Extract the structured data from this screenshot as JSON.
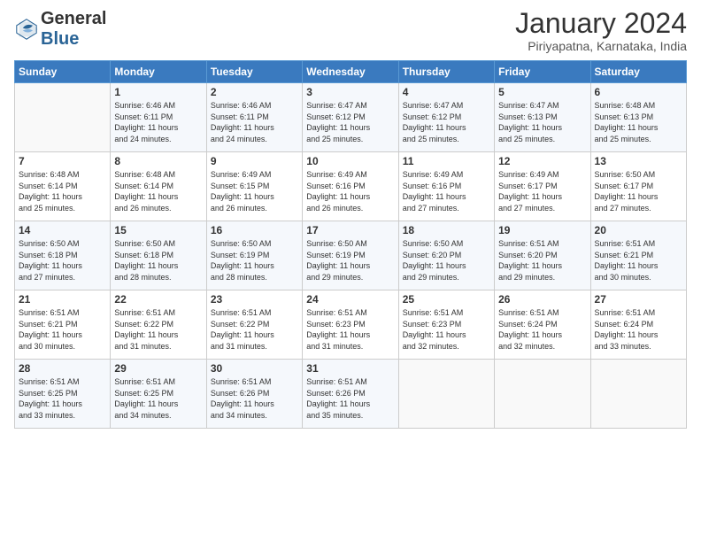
{
  "logo": {
    "general": "General",
    "blue": "Blue"
  },
  "header": {
    "month": "January 2024",
    "location": "Piriyapatna, Karnataka, India"
  },
  "days_of_week": [
    "Sunday",
    "Monday",
    "Tuesday",
    "Wednesday",
    "Thursday",
    "Friday",
    "Saturday"
  ],
  "weeks": [
    [
      {
        "day": "",
        "info": ""
      },
      {
        "day": "1",
        "info": "Sunrise: 6:46 AM\nSunset: 6:11 PM\nDaylight: 11 hours\nand 24 minutes."
      },
      {
        "day": "2",
        "info": "Sunrise: 6:46 AM\nSunset: 6:11 PM\nDaylight: 11 hours\nand 24 minutes."
      },
      {
        "day": "3",
        "info": "Sunrise: 6:47 AM\nSunset: 6:12 PM\nDaylight: 11 hours\nand 25 minutes."
      },
      {
        "day": "4",
        "info": "Sunrise: 6:47 AM\nSunset: 6:12 PM\nDaylight: 11 hours\nand 25 minutes."
      },
      {
        "day": "5",
        "info": "Sunrise: 6:47 AM\nSunset: 6:13 PM\nDaylight: 11 hours\nand 25 minutes."
      },
      {
        "day": "6",
        "info": "Sunrise: 6:48 AM\nSunset: 6:13 PM\nDaylight: 11 hours\nand 25 minutes."
      }
    ],
    [
      {
        "day": "7",
        "info": "Sunrise: 6:48 AM\nSunset: 6:14 PM\nDaylight: 11 hours\nand 25 minutes."
      },
      {
        "day": "8",
        "info": "Sunrise: 6:48 AM\nSunset: 6:14 PM\nDaylight: 11 hours\nand 26 minutes."
      },
      {
        "day": "9",
        "info": "Sunrise: 6:49 AM\nSunset: 6:15 PM\nDaylight: 11 hours\nand 26 minutes."
      },
      {
        "day": "10",
        "info": "Sunrise: 6:49 AM\nSunset: 6:16 PM\nDaylight: 11 hours\nand 26 minutes."
      },
      {
        "day": "11",
        "info": "Sunrise: 6:49 AM\nSunset: 6:16 PM\nDaylight: 11 hours\nand 27 minutes."
      },
      {
        "day": "12",
        "info": "Sunrise: 6:49 AM\nSunset: 6:17 PM\nDaylight: 11 hours\nand 27 minutes."
      },
      {
        "day": "13",
        "info": "Sunrise: 6:50 AM\nSunset: 6:17 PM\nDaylight: 11 hours\nand 27 minutes."
      }
    ],
    [
      {
        "day": "14",
        "info": "Sunrise: 6:50 AM\nSunset: 6:18 PM\nDaylight: 11 hours\nand 27 minutes."
      },
      {
        "day": "15",
        "info": "Sunrise: 6:50 AM\nSunset: 6:18 PM\nDaylight: 11 hours\nand 28 minutes."
      },
      {
        "day": "16",
        "info": "Sunrise: 6:50 AM\nSunset: 6:19 PM\nDaylight: 11 hours\nand 28 minutes."
      },
      {
        "day": "17",
        "info": "Sunrise: 6:50 AM\nSunset: 6:19 PM\nDaylight: 11 hours\nand 29 minutes."
      },
      {
        "day": "18",
        "info": "Sunrise: 6:50 AM\nSunset: 6:20 PM\nDaylight: 11 hours\nand 29 minutes."
      },
      {
        "day": "19",
        "info": "Sunrise: 6:51 AM\nSunset: 6:20 PM\nDaylight: 11 hours\nand 29 minutes."
      },
      {
        "day": "20",
        "info": "Sunrise: 6:51 AM\nSunset: 6:21 PM\nDaylight: 11 hours\nand 30 minutes."
      }
    ],
    [
      {
        "day": "21",
        "info": "Sunrise: 6:51 AM\nSunset: 6:21 PM\nDaylight: 11 hours\nand 30 minutes."
      },
      {
        "day": "22",
        "info": "Sunrise: 6:51 AM\nSunset: 6:22 PM\nDaylight: 11 hours\nand 31 minutes."
      },
      {
        "day": "23",
        "info": "Sunrise: 6:51 AM\nSunset: 6:22 PM\nDaylight: 11 hours\nand 31 minutes."
      },
      {
        "day": "24",
        "info": "Sunrise: 6:51 AM\nSunset: 6:23 PM\nDaylight: 11 hours\nand 31 minutes."
      },
      {
        "day": "25",
        "info": "Sunrise: 6:51 AM\nSunset: 6:23 PM\nDaylight: 11 hours\nand 32 minutes."
      },
      {
        "day": "26",
        "info": "Sunrise: 6:51 AM\nSunset: 6:24 PM\nDaylight: 11 hours\nand 32 minutes."
      },
      {
        "day": "27",
        "info": "Sunrise: 6:51 AM\nSunset: 6:24 PM\nDaylight: 11 hours\nand 33 minutes."
      }
    ],
    [
      {
        "day": "28",
        "info": "Sunrise: 6:51 AM\nSunset: 6:25 PM\nDaylight: 11 hours\nand 33 minutes."
      },
      {
        "day": "29",
        "info": "Sunrise: 6:51 AM\nSunset: 6:25 PM\nDaylight: 11 hours\nand 34 minutes."
      },
      {
        "day": "30",
        "info": "Sunrise: 6:51 AM\nSunset: 6:26 PM\nDaylight: 11 hours\nand 34 minutes."
      },
      {
        "day": "31",
        "info": "Sunrise: 6:51 AM\nSunset: 6:26 PM\nDaylight: 11 hours\nand 35 minutes."
      },
      {
        "day": "",
        "info": ""
      },
      {
        "day": "",
        "info": ""
      },
      {
        "day": "",
        "info": ""
      }
    ]
  ]
}
